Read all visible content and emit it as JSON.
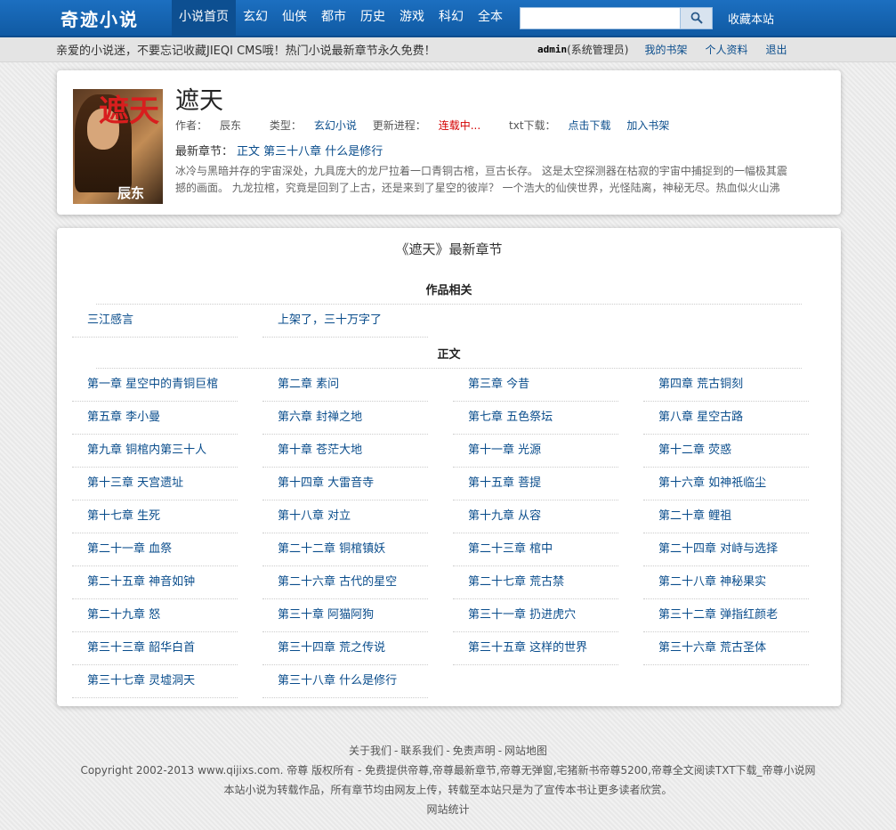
{
  "header": {
    "logo": "奇迹小说",
    "nav": [
      "小说首页",
      "玄幻",
      "仙侠",
      "都市",
      "历史",
      "游戏",
      "科幻",
      "全本"
    ],
    "active_index": 0,
    "search_value": "",
    "fav_label": "收藏本站"
  },
  "subbar": {
    "notice": "亲爱的小说迷，不要忘记收藏JIEQI CMS哦！热门小说最新章节永久免费！",
    "username": "admin",
    "role": "(系统管理员)",
    "links": [
      "我的书架",
      "个人资料",
      "退出"
    ]
  },
  "book": {
    "cover_text_title": "遮天",
    "cover_text_author": "辰东",
    "title": "遮天",
    "author_label": "作者：",
    "author": "辰东",
    "type_label": "类型：",
    "type": "玄幻小说",
    "progress_label": "更新进程：",
    "progress": "连载中...",
    "download_label": "txt下载：",
    "download": "点击下载",
    "add_shelf": "加入书架",
    "latest_label": "最新章节：",
    "latest_chapter": "正文 第三十八章 什么是修行",
    "description": "冰冷与黑暗并存的宇宙深处，九具庞大的龙尸拉着一口青铜古棺，亘古长存。 这是太空探测器在枯寂的宇宙中捕捉到的一幅极其震撼的画面。 九龙拉棺，究竟是回到了上古，还是来到了星空的彼岸？ 一个浩大的仙侠世界，光怪陆离，神秘无尽。热血似火山沸"
  },
  "chapter_list": {
    "title": "《遮天》最新章节",
    "volume1": {
      "name": "作品相关",
      "chapters": [
        "三江感言",
        "上架了，三十万字了"
      ]
    },
    "volume2": {
      "name": "正文",
      "chapters": [
        "第一章 星空中的青铜巨棺",
        "第二章 素问",
        "第三章 今昔",
        "第四章 荒古铜刻",
        "第五章 李小曼",
        "第六章 封禅之地",
        "第七章 五色祭坛",
        "第八章 星空古路",
        "第九章 铜棺内第三十人",
        "第十章 苍茫大地",
        "第十一章 光源",
        "第十二章 荧惑",
        "第十三章 天宫遗址",
        "第十四章 大雷音寺",
        "第十五章 菩提",
        "第十六章 如神祇临尘",
        "第十七章 生死",
        "第十八章 对立",
        "第十九章 从容",
        "第二十章 鲤祖",
        "第二十一章 血祭",
        "第二十二章 铜棺镇妖",
        "第二十三章 棺中",
        "第二十四章 对峙与选择",
        "第二十五章 神音如钟",
        "第二十六章 古代的星空",
        "第二十七章 荒古禁",
        "第二十八章 神秘果实",
        "第二十九章 怒",
        "第三十章 阿猫阿狗",
        "第三十一章 扔进虎穴",
        "第三十二章 弹指红颜老",
        "第三十三章 韶华白首",
        "第三十四章 荒之传说",
        "第三十五章 这样的世界",
        "第三十六章 荒古圣体",
        "第三十七章 灵墟洞天",
        "第三十八章 什么是修行"
      ]
    }
  },
  "footer": {
    "links": [
      "关于我们",
      "联系我们",
      "免责声明",
      "网站地图"
    ],
    "copyright": "Copyright 2002-2013 www.qijixs.com. 帝尊 版权所有 - 免费提供帝尊,帝尊最新章节,帝尊无弹窗,宅猪新书帝尊5200,帝尊全文阅读TXT下载_帝尊小说网",
    "disclaimer": "本站小说为转载作品，所有章节均由网友上传，转载至本站只是为了宣传本书让更多读者欣赏。",
    "stats": "网站统计"
  }
}
